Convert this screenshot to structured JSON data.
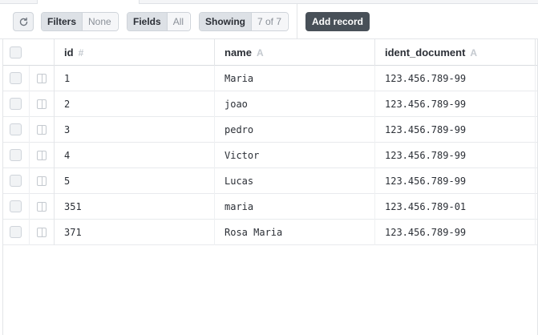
{
  "toolbar": {
    "refresh_icon": "refresh-icon",
    "filters_label": "Filters",
    "filters_value": "None",
    "fields_label": "Fields",
    "fields_value": "All",
    "showing_label": "Showing",
    "showing_value": "7 of 7",
    "add_record_label": "Add record"
  },
  "columns": [
    {
      "label": "id",
      "type_icon": "#"
    },
    {
      "label": "name",
      "type_icon": "A"
    },
    {
      "label": "ident_document",
      "type_icon": "A"
    }
  ],
  "rows": [
    {
      "id": "1",
      "name": "Maria",
      "ident_document": "123.456.789-99"
    },
    {
      "id": "2",
      "name": "joao",
      "ident_document": "123.456.789-99"
    },
    {
      "id": "3",
      "name": "pedro",
      "ident_document": "123.456.789-99"
    },
    {
      "id": "4",
      "name": "Victor",
      "ident_document": "123.456.789-99"
    },
    {
      "id": "5",
      "name": "Lucas",
      "ident_document": "123.456.789-99"
    },
    {
      "id": "351",
      "name": "maria",
      "ident_document": "123.456.789-01"
    },
    {
      "id": "371",
      "name": "Rosa Maria",
      "ident_document": "123.456.789-99"
    }
  ],
  "colors": {
    "add_button_bg": "#485058",
    "segment_key_bg": "#dde1e6",
    "border": "#cfd4da"
  }
}
